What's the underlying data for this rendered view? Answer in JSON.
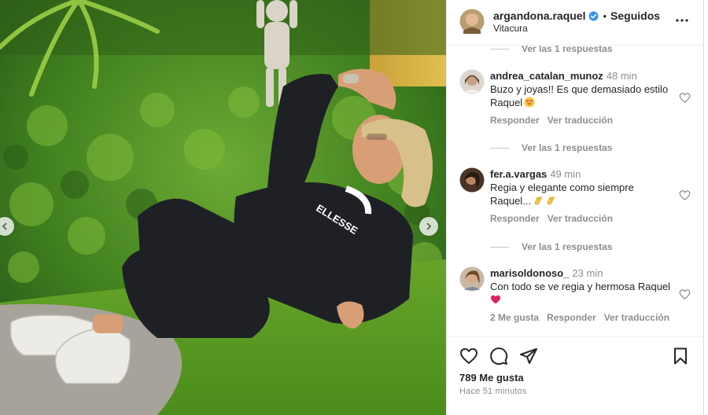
{
  "post": {
    "author": "argandona.raquel",
    "verified": true,
    "separator": "•",
    "follow_status": "Seguidos",
    "location": "Vitacura",
    "photo_shirt_text": "ELLESSE"
  },
  "comments": [
    {
      "replies_label": "Ver las 1 respuestas"
    },
    {
      "user": "andrea_catalan_munoz",
      "time": "48 min",
      "text": "Buzo y joyas!! Es que demasiado estilo Raquel",
      "emoji": "heart-eyes",
      "actions": [
        "Responder",
        "Ver traducción"
      ],
      "replies_label": "Ver las 1 respuestas"
    },
    {
      "user": "fer.a.vargas",
      "time": "49 min",
      "text": "Regia y elegante como siempre Raquel...",
      "emoji": "clapping-hands",
      "actions": [
        "Responder",
        "Ver traducción"
      ],
      "replies_label": "Ver las 1 respuestas"
    },
    {
      "user": "marisoldonoso_",
      "time": "23 min",
      "text": "Con todo se ve regia y hermosa Raquel",
      "emoji": "red-heart",
      "actions": [
        "2 Me gusta",
        "Responder",
        "Ver traducción"
      ]
    }
  ],
  "footer": {
    "likes": "789 Me gusta",
    "time_ago": "Hace 51 minutos"
  },
  "icons": {
    "like": "heart-icon",
    "comment": "comment-icon",
    "share": "share-icon",
    "save": "bookmark-icon",
    "more": "more-options-icon",
    "verified": "verified-badge-icon"
  },
  "colors": {
    "verified_blue": "#3897f0",
    "muted_text": "#8e8e8e",
    "primary_text": "#262626"
  }
}
